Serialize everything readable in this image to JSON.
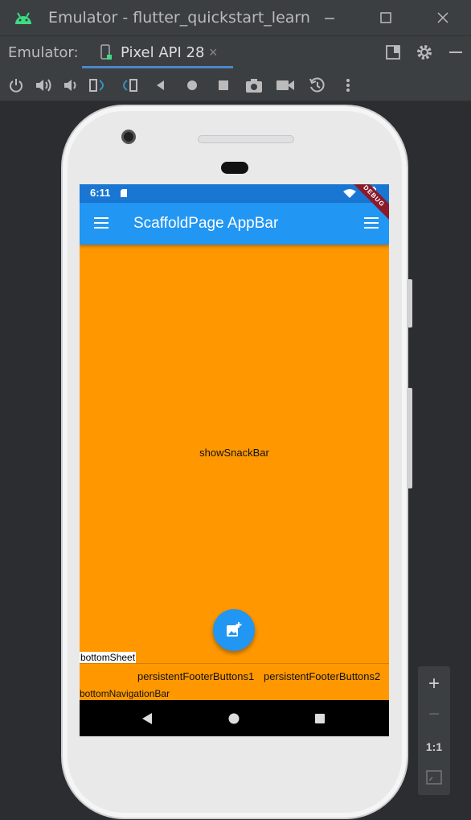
{
  "window": {
    "title": "Emulator - flutter_quickstart_learn",
    "icons": [
      "android-icon",
      "minimize-icon",
      "maximize-icon",
      "close-icon"
    ]
  },
  "tool_window": {
    "label": "Emulator:",
    "tab_label": "Pixel API 28",
    "tab_close": "×",
    "icons": [
      "device-icon",
      "restore-layout-icon",
      "settings-icon",
      "hide-icon"
    ]
  },
  "toolbar": {
    "icons": [
      "power-icon",
      "volume-up-icon",
      "volume-down-icon",
      "rotate-left-icon",
      "rotate-right-icon",
      "back-icon",
      "home-icon",
      "overview-icon",
      "screenshot-icon",
      "screen-record-icon",
      "snapshot-icon",
      "more-icon"
    ]
  },
  "app": {
    "status_time": "6:11",
    "debug_label": "DEBUG",
    "appbar_title": "ScaffoldPage AppBar",
    "body_text": "showSnackBar",
    "bottom_sheet": "bottomSheet",
    "footer_buttons": [
      "persistentFooterButtons1",
      "persistentFooterButtons2"
    ],
    "bottom_navigation_bar": "bottomNavigationBar",
    "colors": {
      "appbar": "#2196f3",
      "statusbar": "#1976d2",
      "body": "#ff9800",
      "fab": "#2196f3"
    }
  },
  "zoom": {
    "zoom_in": "+",
    "zoom_out": "−",
    "one_to_one": "1:1"
  }
}
